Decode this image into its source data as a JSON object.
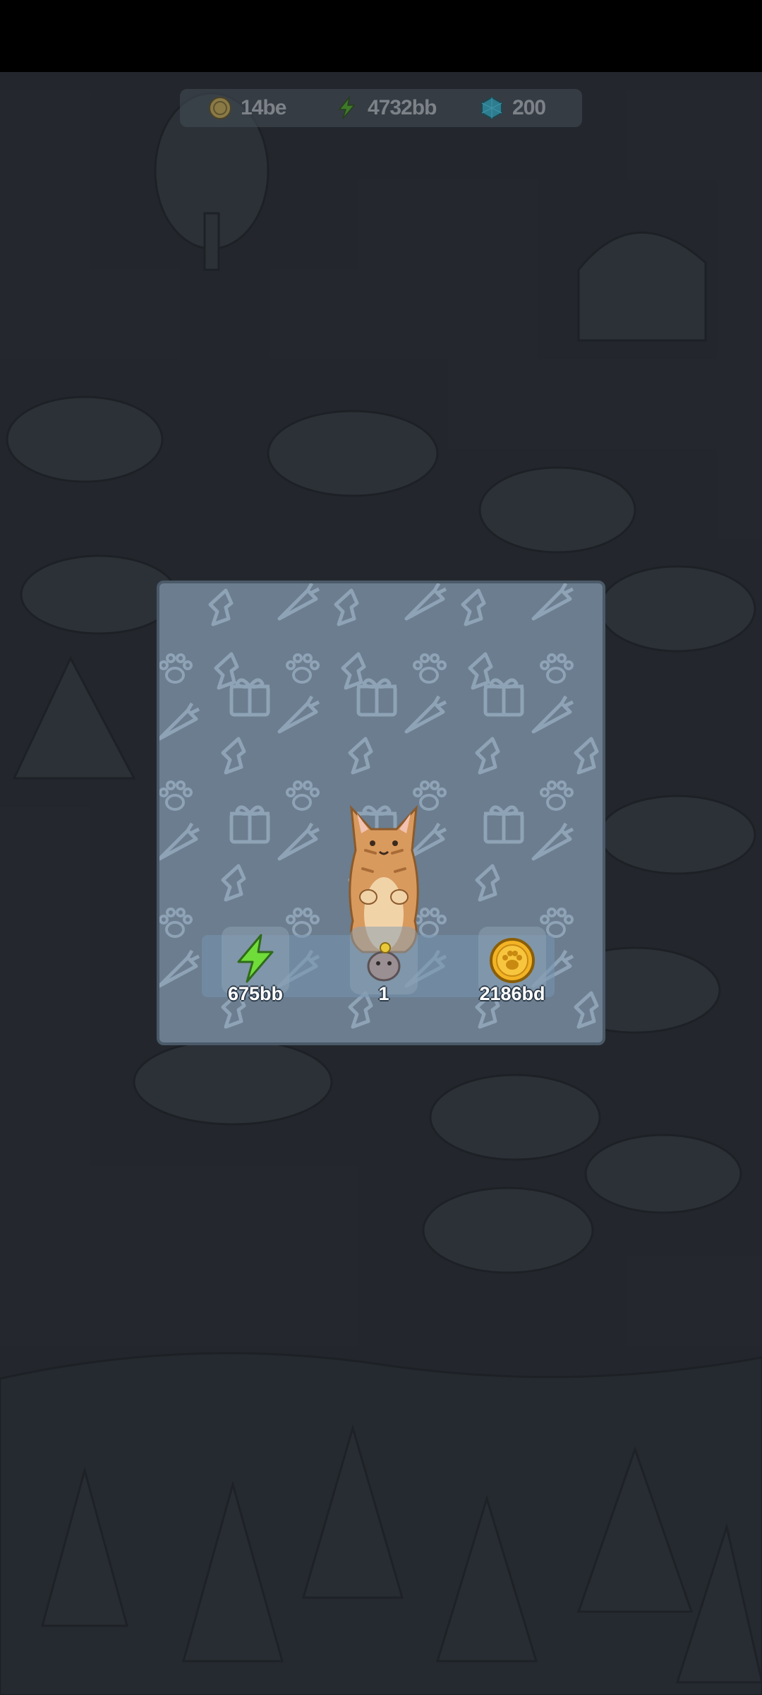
{
  "top_bar": {
    "coins": {
      "icon": "coin-icon",
      "value": "14be"
    },
    "energy": {
      "icon": "lightning-icon",
      "value": "4732bb"
    },
    "gems": {
      "icon": "gem-icon",
      "value": "200"
    }
  },
  "reward_panel": {
    "character": "cat-character",
    "rewards": [
      {
        "icon": "lightning-icon",
        "label": "675bb"
      },
      {
        "icon": "creature-icon",
        "label": "1"
      },
      {
        "icon": "paw-coin-icon",
        "label": "2186bd"
      }
    ]
  },
  "colors": {
    "background": "#2c3137",
    "panel": "#6b7d8f",
    "pattern": "#8fa3b6",
    "energy": "#6fdc3a",
    "coin": "#f2b325"
  }
}
